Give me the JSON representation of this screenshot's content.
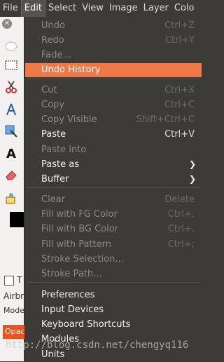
{
  "menubar": {
    "items": [
      "File",
      "Edit",
      "Select",
      "View",
      "Image",
      "Layer",
      "Colo"
    ]
  },
  "toolbox": {
    "tool_icons": [
      "ellipse-select-icon",
      "rect-select-icon",
      "scissors-icon",
      "fuzzy-select-icon",
      "transform-icon",
      "text-tool-icon",
      "eraser-icon",
      "clone-icon"
    ],
    "options_labels": [
      "T",
      "Airbru",
      "Mode"
    ],
    "opacity_label": "Opac"
  },
  "edit_menu": {
    "items": [
      {
        "label": "Undo",
        "accel": "Ctrl+Z",
        "disabled": true
      },
      {
        "label": "Redo",
        "accel": "Ctrl+Y",
        "disabled": true
      },
      {
        "label": "Fade...",
        "accel": "",
        "disabled": true
      },
      {
        "label": "Undo History",
        "accel": "",
        "disabled": false,
        "highlighted": true
      },
      {
        "label": "Cut",
        "accel": "Ctrl+X",
        "disabled": true
      },
      {
        "label": "Copy",
        "accel": "Ctrl+C",
        "disabled": true
      },
      {
        "label": "Copy Visible",
        "accel": "Shift+Ctrl+C",
        "disabled": true
      },
      {
        "label": "Paste",
        "accel": "Ctrl+V",
        "disabled": false
      },
      {
        "label": "Paste Into",
        "accel": "",
        "disabled": true
      },
      {
        "label": "Paste as",
        "accel": "",
        "disabled": false,
        "submenu": true
      },
      {
        "label": "Buffer",
        "accel": "",
        "disabled": false,
        "submenu": true
      },
      {
        "label": "Clear",
        "accel": "Delete",
        "disabled": true
      },
      {
        "label": "Fill with FG Color",
        "accel": "Ctrl+,",
        "disabled": true
      },
      {
        "label": "Fill with BG Color",
        "accel": "Ctrl+.",
        "disabled": true
      },
      {
        "label": "Fill with Pattern",
        "accel": "Ctrl+;",
        "disabled": true
      },
      {
        "label": "Stroke Selection...",
        "accel": "",
        "disabled": true
      },
      {
        "label": "Stroke Path...",
        "accel": "",
        "disabled": true
      },
      {
        "label": "Preferences",
        "accel": "",
        "disabled": false
      },
      {
        "label": "Input Devices",
        "accel": "",
        "disabled": false
      },
      {
        "label": "Keyboard Shortcuts",
        "accel": "",
        "disabled": false
      },
      {
        "label": "Modules",
        "accel": "",
        "disabled": false
      },
      {
        "label": "Units",
        "accel": "",
        "disabled": false
      }
    ]
  },
  "watermark": "http://blog.csdn.net/chengyq116",
  "colors": {
    "menu_bg": "#3c3b37",
    "highlight": "#f07746",
    "toolbox_bg": "#f2f1f0"
  }
}
